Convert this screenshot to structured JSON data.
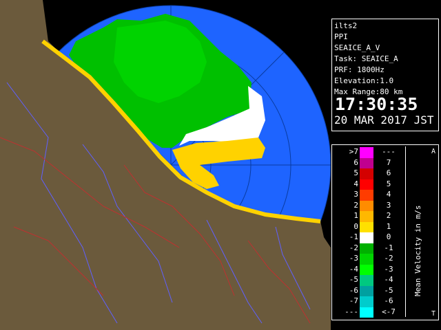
{
  "radar_info": {
    "site": "ilts2",
    "product": "PPI",
    "volume": "SEAICE_A_V",
    "task": "Task: SEAICE_A",
    "prf": "PRF: 1800Hz",
    "elevation": "Elevation:1.0",
    "max_range": "Max Range:80 km",
    "time": "17:30:35",
    "date": "20 MAR 2017 JST"
  },
  "legend": {
    "title": "Mean Velocity in m/s",
    "corner_top": "A",
    "corner_bottom": "T",
    "rows": [
      {
        "left": ">7",
        "color": "#ff00ff",
        "right": "---"
      },
      {
        "left": "6",
        "color": "#c0008f",
        "right": "7"
      },
      {
        "left": "5",
        "color": "#d40000",
        "right": "6"
      },
      {
        "left": "4",
        "color": "#ff0000",
        "right": "5"
      },
      {
        "left": "3",
        "color": "#ff3c00",
        "right": "4"
      },
      {
        "left": "2",
        "color": "#ff8c00",
        "right": "3"
      },
      {
        "left": "1",
        "color": "#ffb800",
        "right": "2"
      },
      {
        "left": "0",
        "color": "#ffe000",
        "right": "1"
      },
      {
        "left": "-1",
        "color": "#ffffff",
        "right": "0"
      },
      {
        "left": "-2",
        "color": "#00b000",
        "right": "-1"
      },
      {
        "left": "-3",
        "color": "#00d400",
        "right": "-2"
      },
      {
        "left": "-4",
        "color": "#00ff00",
        "right": "-3"
      },
      {
        "left": "-5",
        "color": "#00c880",
        "right": "-4"
      },
      {
        "left": "-6",
        "color": "#00a0a0",
        "right": "-5"
      },
      {
        "left": "-7",
        "color": "#00cccc",
        "right": "-6"
      },
      {
        "left": "---",
        "color": "#00ffff",
        "right": "<-7"
      }
    ]
  },
  "colors": {
    "land": "#6b5a3c",
    "range_ring": "#1e64ff",
    "ice_green": "#00c000",
    "ice_yellow": "#ffd200"
  }
}
